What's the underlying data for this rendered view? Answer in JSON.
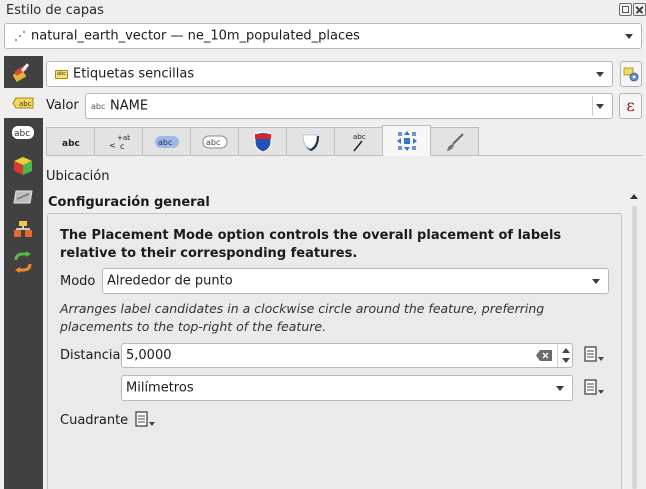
{
  "window": {
    "title": "Estilo de capas"
  },
  "layer_selector": {
    "value": "natural_earth_vector — ne_10m_populated_places"
  },
  "sidebar": {
    "items": [
      {
        "icon": "symbology-icon"
      },
      {
        "icon": "labels-icon",
        "active": true
      },
      {
        "icon": "masks-icon"
      },
      {
        "icon": "3d-view-icon"
      },
      {
        "icon": "diagrams-icon"
      },
      {
        "icon": "fields-icon"
      },
      {
        "icon": "history-icon"
      }
    ]
  },
  "label_mode": {
    "value": "Etiquetas sencillas"
  },
  "value_row": {
    "label": "Valor",
    "field": "NAME",
    "field_type": "abc"
  },
  "tabs": [
    {
      "name": "text-tab",
      "active": false
    },
    {
      "name": "formatting-tab",
      "active": false
    },
    {
      "name": "buffer-tab",
      "active": false
    },
    {
      "name": "mask-tab",
      "active": false
    },
    {
      "name": "background-tab",
      "active": false
    },
    {
      "name": "shadow-tab",
      "active": false
    },
    {
      "name": "callouts-tab",
      "active": false
    },
    {
      "name": "placement-tab",
      "active": true
    },
    {
      "name": "rendering-tab",
      "active": false
    }
  ],
  "section": {
    "title": "Ubicación"
  },
  "general": {
    "title": "Configuración general",
    "description": "The Placement Mode option controls the overall placement of labels relative to their corresponding features.",
    "mode_label": "Modo",
    "mode_value": "Alrededor de punto",
    "mode_description": "Arranges label candidates in a clockwise circle around the feature, preferring placements to the top-right of the feature.",
    "distance_label": "Distancia",
    "distance_value": "5,0000",
    "distance_unit": "Milímetros",
    "quadrant_label": "Cuadrante"
  }
}
